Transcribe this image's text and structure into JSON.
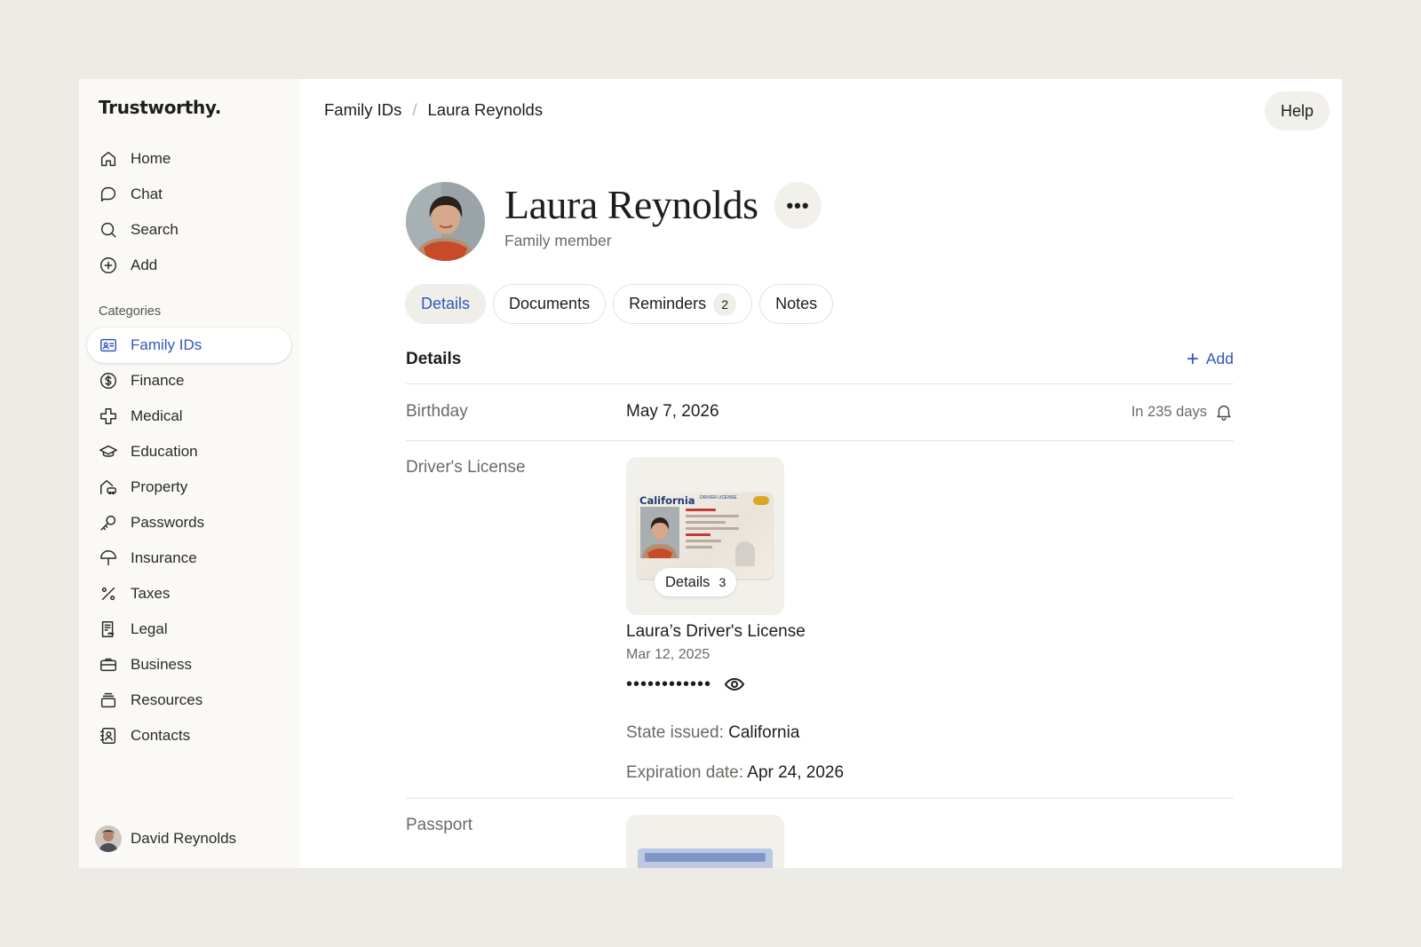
{
  "brand": "Trustworthy.",
  "nav": {
    "items": [
      {
        "label": "Home",
        "icon": "home-icon"
      },
      {
        "label": "Chat",
        "icon": "chat-icon"
      },
      {
        "label": "Search",
        "icon": "search-icon"
      },
      {
        "label": "Add",
        "icon": "plus-circle-icon"
      }
    ]
  },
  "categories": {
    "heading": "Categories",
    "items": [
      {
        "label": "Family IDs",
        "icon": "id-card-icon",
        "active": true
      },
      {
        "label": "Finance",
        "icon": "dollar-icon"
      },
      {
        "label": "Medical",
        "icon": "medical-cross-icon"
      },
      {
        "label": "Education",
        "icon": "graduation-cap-icon"
      },
      {
        "label": "Property",
        "icon": "house-car-icon"
      },
      {
        "label": "Passwords",
        "icon": "key-icon"
      },
      {
        "label": "Insurance",
        "icon": "umbrella-icon"
      },
      {
        "label": "Taxes",
        "icon": "percent-icon"
      },
      {
        "label": "Legal",
        "icon": "legal-document-icon"
      },
      {
        "label": "Business",
        "icon": "briefcase-icon"
      },
      {
        "label": "Resources",
        "icon": "stack-icon"
      },
      {
        "label": "Contacts",
        "icon": "contact-book-icon"
      }
    ]
  },
  "user": {
    "name": "David Reynolds"
  },
  "breadcrumb": {
    "parent": "Family IDs",
    "separator": "/",
    "current": "Laura Reynolds"
  },
  "help_label": "Help",
  "profile": {
    "name": "Laura Reynolds",
    "role": "Family member",
    "more_label": "•••"
  },
  "tabs": [
    {
      "label": "Details",
      "active": true
    },
    {
      "label": "Documents"
    },
    {
      "label": "Reminders",
      "count": "2"
    },
    {
      "label": "Notes"
    }
  ],
  "details": {
    "title": "Details",
    "add_label": "Add",
    "add_icon": "+",
    "birthday": {
      "label": "Birthday",
      "value": "May 7, 2026",
      "reminder": "In 235 days"
    },
    "license": {
      "label": "Driver's License",
      "card_state": "California",
      "card_type": "DRIVER LICENSE",
      "details_label": "Details",
      "details_count": "3",
      "title": "Laura’s Driver's License",
      "date": "Mar 12, 2025",
      "masked_number": "••••••••••••",
      "state_label": "State issued:",
      "state_value": "California",
      "exp_label": "Expiration date:",
      "exp_value": "Apr 24, 2026"
    },
    "passport": {
      "label": "Passport"
    }
  },
  "colors": {
    "accent": "#3556b8",
    "background": "#ecebe5",
    "sidebar": "#faf9f6"
  }
}
